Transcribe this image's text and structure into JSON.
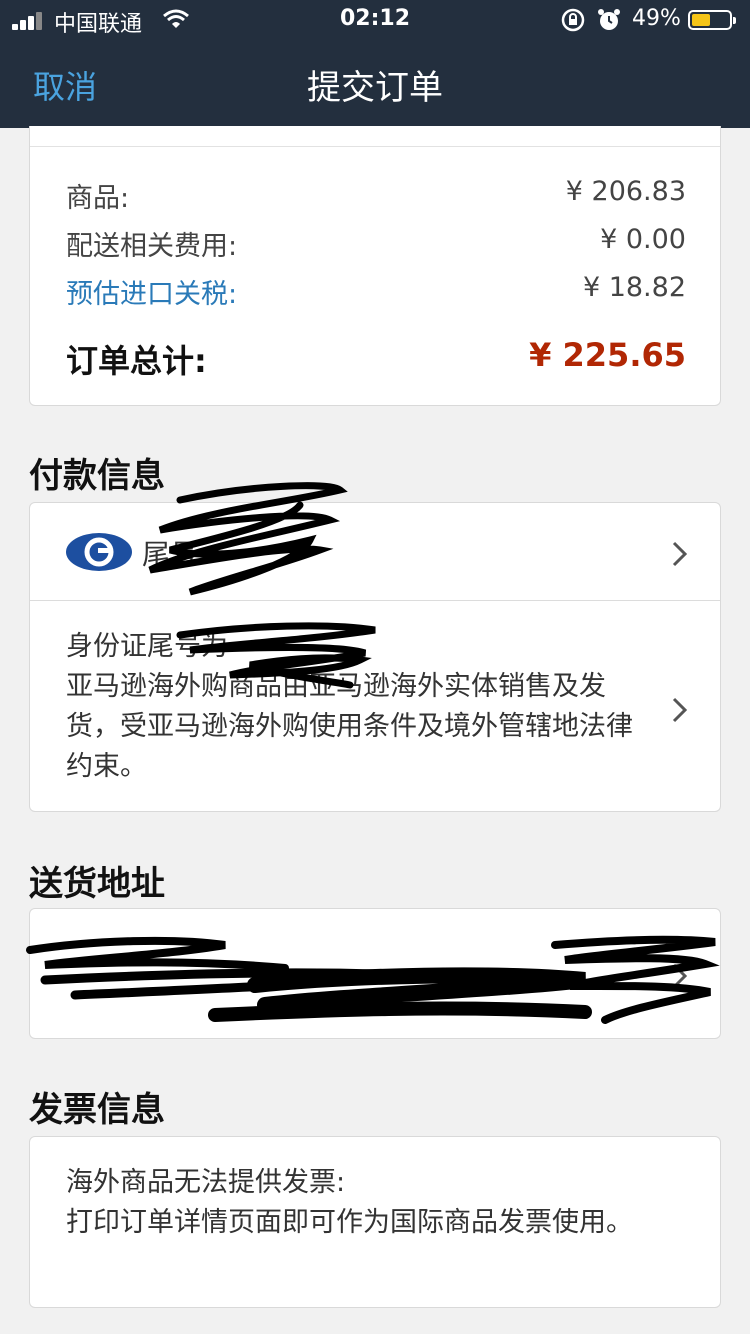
{
  "status_bar": {
    "carrier": "中国联通",
    "time": "02:12",
    "battery": "49%",
    "battery_level": 0.49
  },
  "nav": {
    "cancel": "取消",
    "title": "提交订单"
  },
  "summary": {
    "items_label": "商品:",
    "items_value": "¥ 206.83",
    "shipping_label": "配送相关费用:",
    "shipping_value": "¥ 0.00",
    "tax_label": "预估进口关税:",
    "tax_value": "¥ 18.82",
    "total_label": "订单总计:",
    "total_value": "¥ 225.65"
  },
  "payment": {
    "section_title": "付款信息",
    "card_tail": "尾号",
    "id_line": "身份证尾号为",
    "notice": "亚马逊海外购商品由亚马逊海外实体销售及发货，受亚马逊海外购使用条件及境外管辖地法律约束。"
  },
  "shipping": {
    "section_title": "送货地址"
  },
  "invoice": {
    "section_title": "发票信息",
    "line1": "海外商品无法提供发票:",
    "line2": "打印订单详情页面即可作为国际商品发票使用。"
  },
  "colors": {
    "header_bg": "#232f3e",
    "link": "#2a7ab8",
    "total": "#b12704",
    "cancel": "#4aa3df"
  },
  "icons": {
    "card_chevron": "chevron-right-icon",
    "bank_logo": "bank-logo-icon"
  }
}
